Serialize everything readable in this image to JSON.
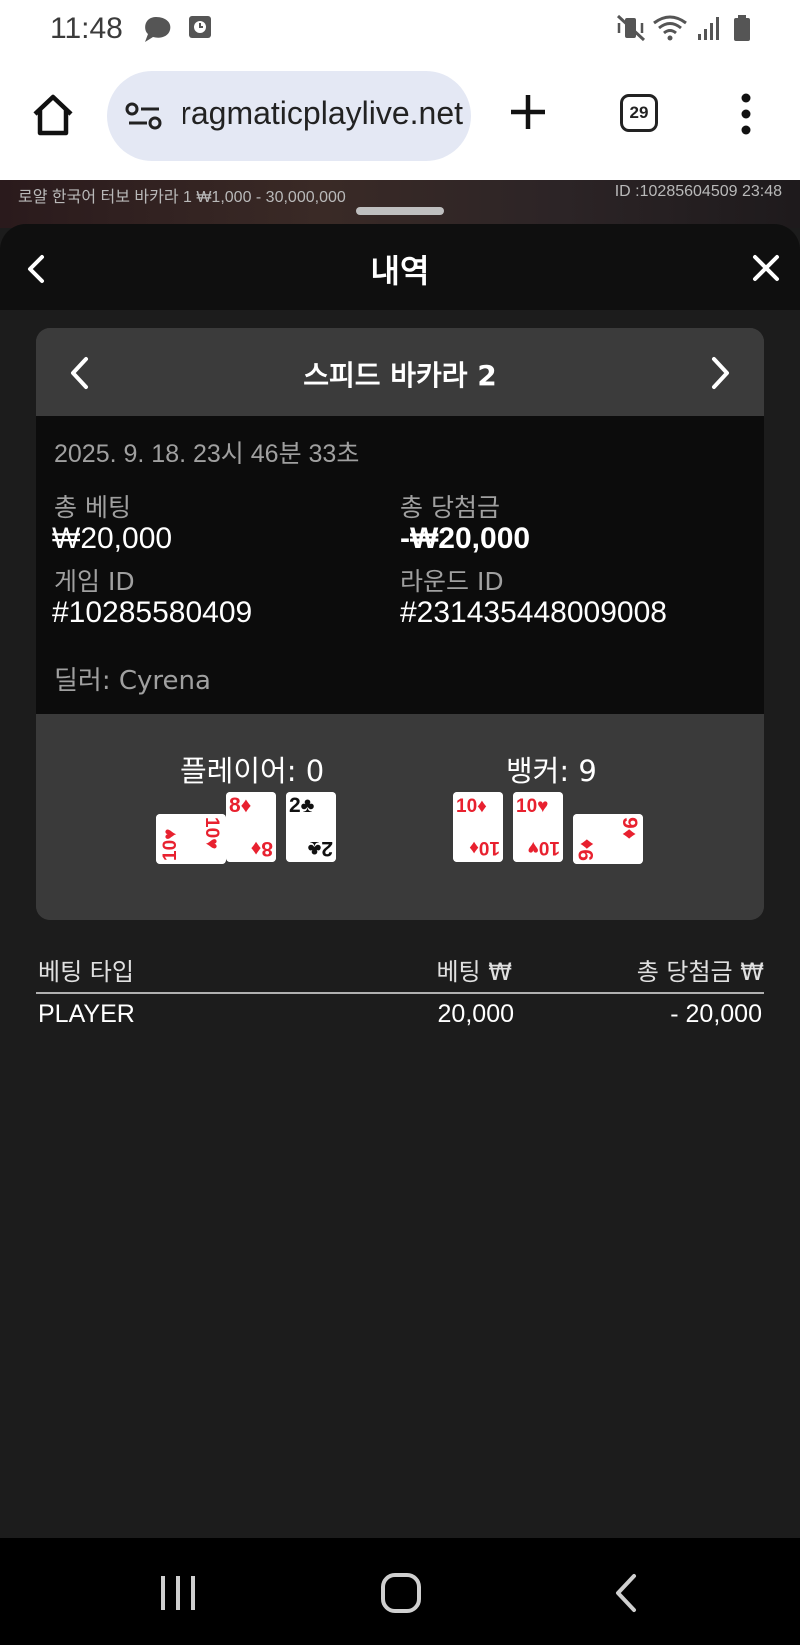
{
  "status_bar": {
    "time": "11:48"
  },
  "browser": {
    "url": "pragmaticplaylive.net",
    "tab_count": "29"
  },
  "game_strip": {
    "left_text": "로얄 한국어 터보 바카라 1 ₩1,000 - 30,000,000",
    "right_text": "ID :10285604509 23:48"
  },
  "sheet": {
    "title": "내역"
  },
  "card": {
    "game_name": "스피드 바카라 2",
    "datetime": "2025. 9. 18. 23시 46분 33초",
    "total_bet_label": "총 베팅",
    "total_bet_value": "₩20,000",
    "total_win_label": "총 당첨금",
    "total_win_value": "-₩20,000",
    "game_id_label": "게임 ID",
    "game_id_value": "#10285580409",
    "round_id_label": "라운드 ID",
    "round_id_value": "#231435448009008",
    "dealer": "딜러: Cyrena"
  },
  "result": {
    "player_label": "플레이어: 0",
    "banker_label": "뱅커: 9",
    "player_cards": [
      {
        "rank": "10",
        "suit": "♥",
        "color": "#e8212f",
        "rotated": true
      },
      {
        "rank": "8",
        "suit": "♦",
        "color": "#e8212f",
        "rotated": false
      },
      {
        "rank": "2",
        "suit": "♣",
        "color": "#111111",
        "rotated": false
      }
    ],
    "banker_cards": [
      {
        "rank": "10",
        "suit": "♦",
        "color": "#e8212f",
        "rotated": false
      },
      {
        "rank": "10",
        "suit": "♥",
        "color": "#e8212f",
        "rotated": false
      },
      {
        "rank": "9",
        "suit": "♦",
        "color": "#e8212f",
        "rotated": true
      }
    ]
  },
  "bet_table": {
    "headers": [
      "베팅 타입",
      "베팅 ₩",
      "총 당첨금 ₩"
    ],
    "rows": [
      {
        "type": "PLAYER",
        "bet": "20,000",
        "win": "- 20,000"
      }
    ]
  },
  "colors": {
    "sheet_bg": "#1c1c1c",
    "info_bg": "#0c0c0c",
    "card_red": "#e8212f"
  }
}
